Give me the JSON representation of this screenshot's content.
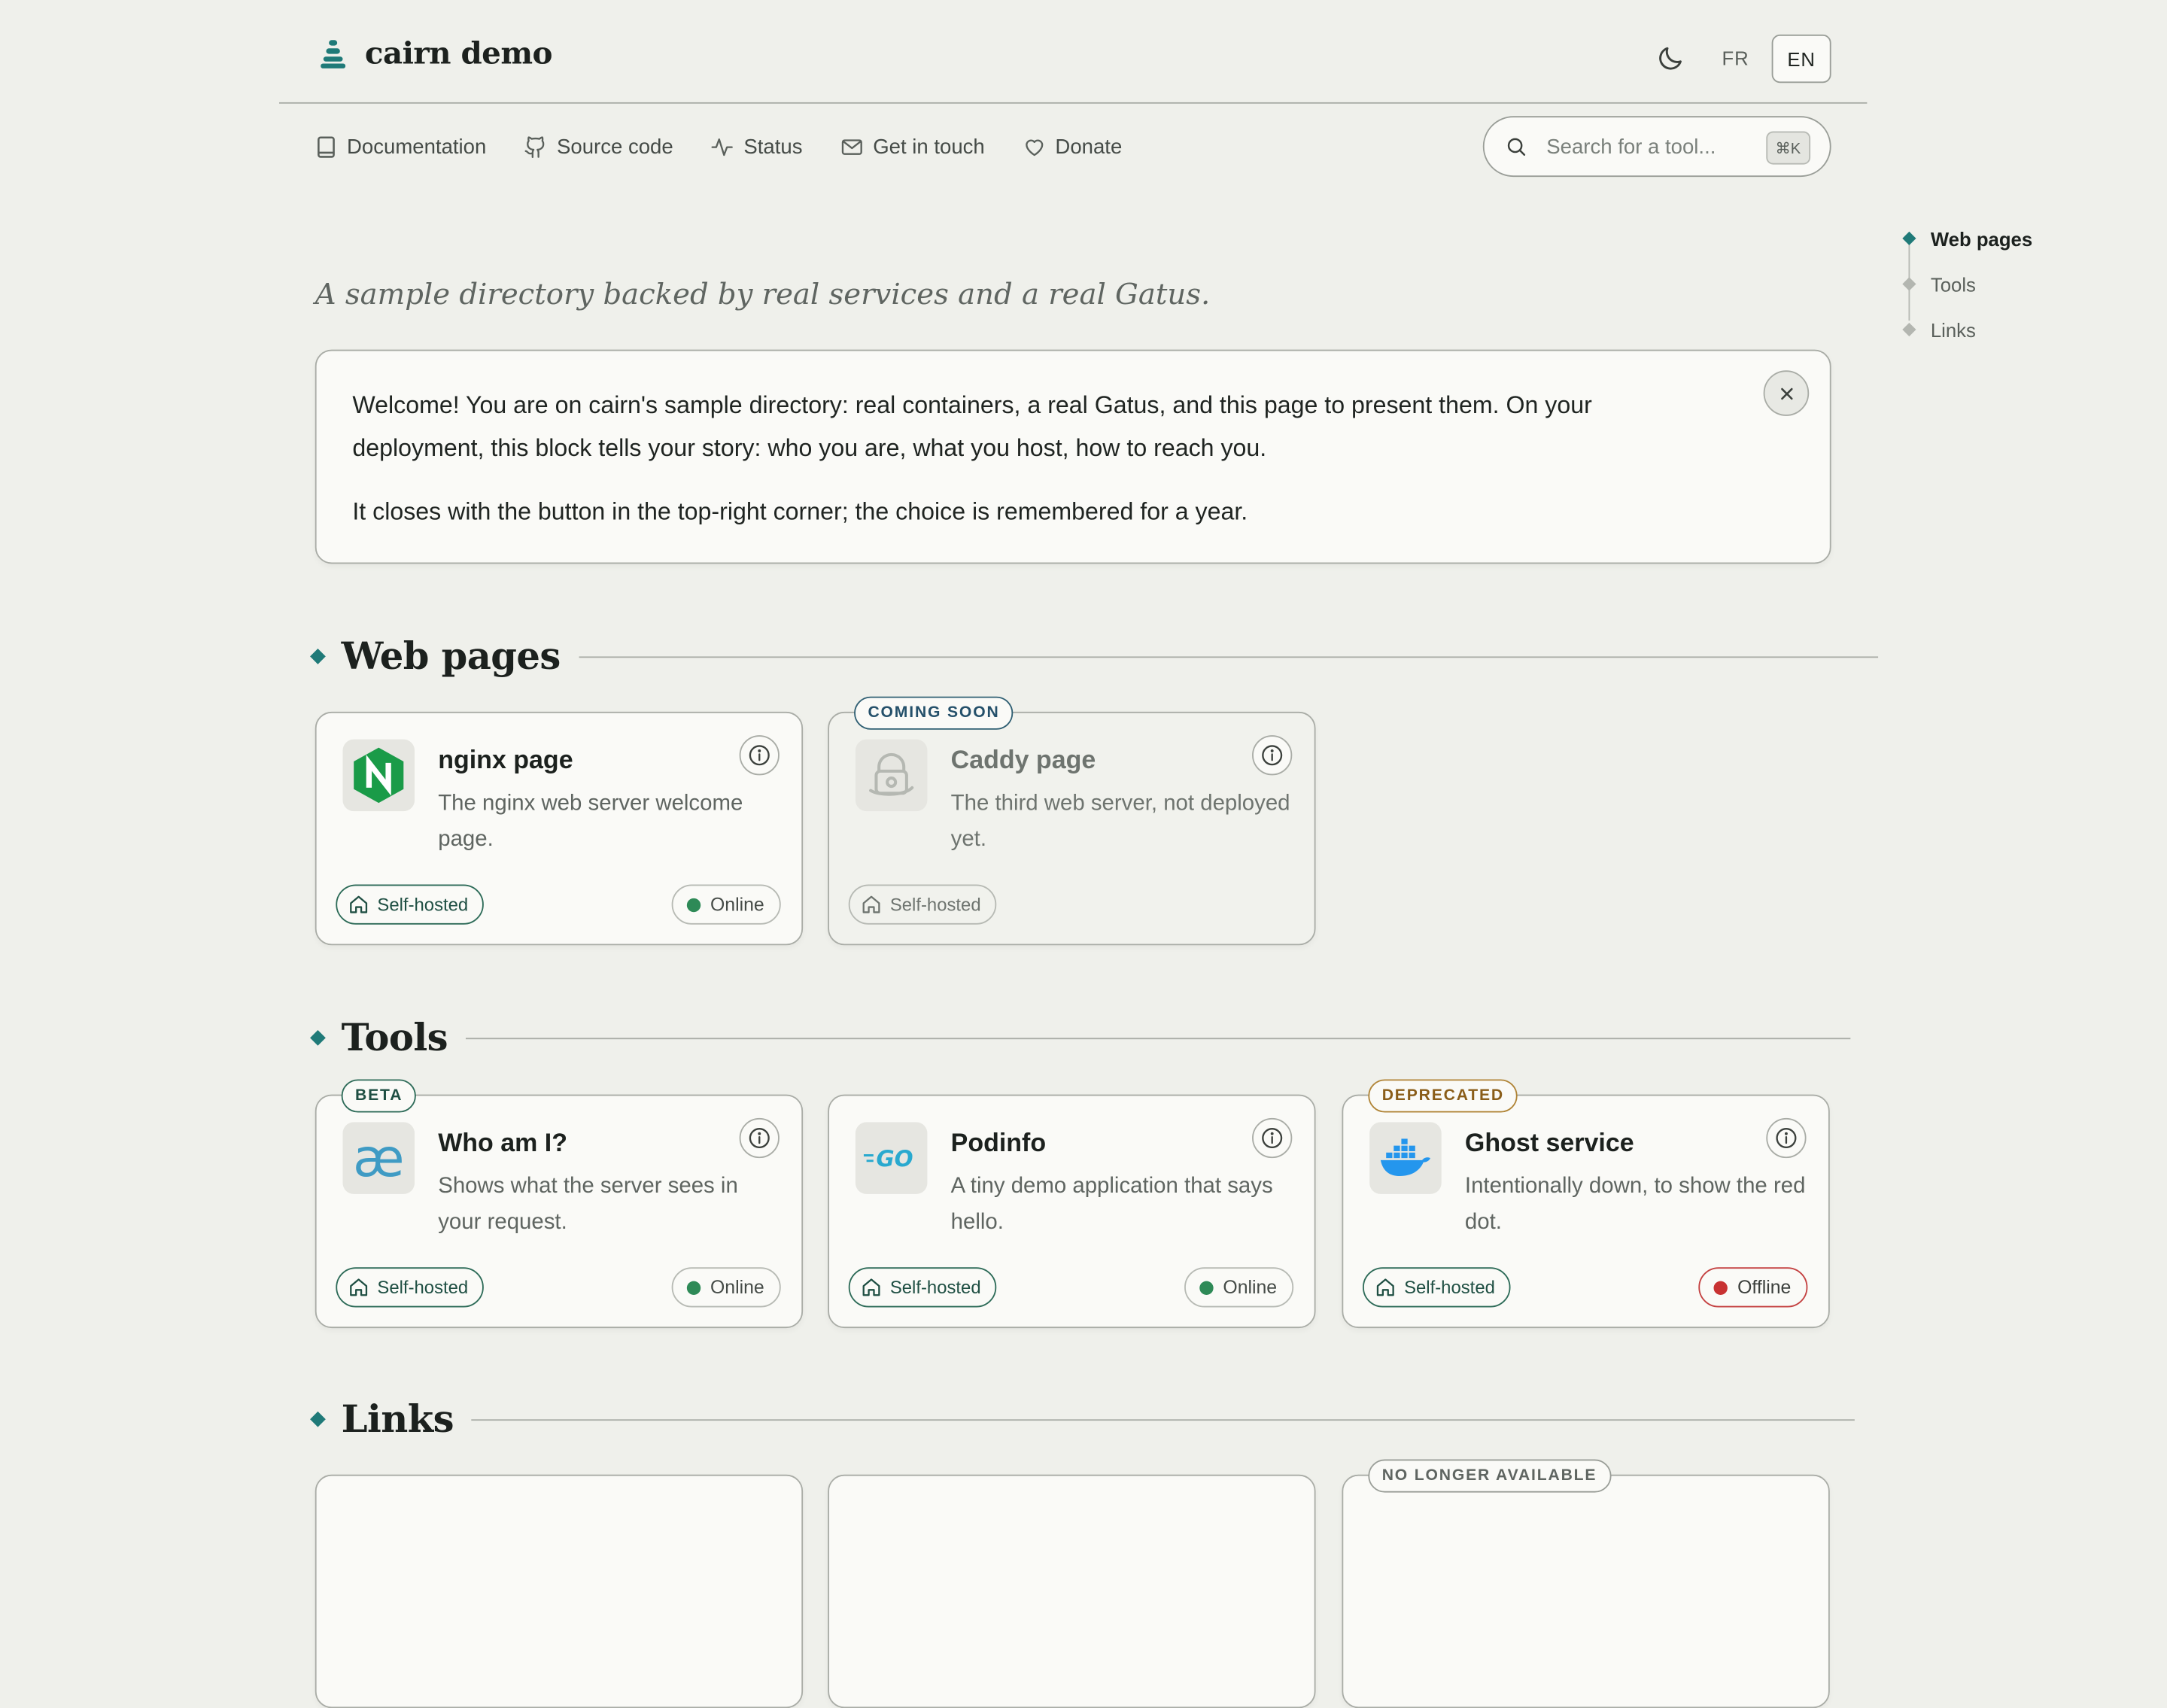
{
  "header": {
    "brand": "cairn demo",
    "lang_fr": "FR",
    "lang_en": "EN"
  },
  "nav": {
    "documentation": "Documentation",
    "source_code": "Source code",
    "status": "Status",
    "get_in_touch": "Get in touch",
    "donate": "Donate"
  },
  "search": {
    "placeholder": "Search for a tool...",
    "shortcut": "⌘K"
  },
  "toc": {
    "items": [
      "Web pages",
      "Tools",
      "Links"
    ],
    "active": "Web pages"
  },
  "tagline": "A sample directory backed by real services and a real Gatus.",
  "welcome": {
    "p1": "Welcome! You are on cairn's sample directory: real containers, a real Gatus, and this page to present them. On your deployment, this block tells your story: who you are, what you host, how to reach you.",
    "p2": "It closes with the button in the top-right corner; the choice is remembered for a year."
  },
  "sections": {
    "web_pages": {
      "title": "Web pages",
      "cards": [
        {
          "name": "nginx page",
          "description": "The nginx web server welcome page.",
          "hosting": "Self-hosted",
          "status": "Online",
          "icon": "nginx-logo"
        },
        {
          "name": "Caddy page",
          "description": "The third web server, not deployed yet.",
          "hosting": "Self-hosted",
          "badge": "COMING SOON",
          "icon": "caddy-logo"
        }
      ]
    },
    "tools": {
      "title": "Tools",
      "cards": [
        {
          "name": "Who am I?",
          "description": "Shows what the server sees in your request.",
          "hosting": "Self-hosted",
          "status": "Online",
          "badge": "BETA",
          "icon": "whoami-logo"
        },
        {
          "name": "Podinfo",
          "description": "A tiny demo application that says hello.",
          "hosting": "Self-hosted",
          "status": "Online",
          "icon": "go-logo"
        },
        {
          "name": "Ghost service",
          "description": "Intentionally down, to show the red dot.",
          "hosting": "Self-hosted",
          "status": "Offline",
          "badge": "DEPRECATED",
          "icon": "docker-logo"
        }
      ]
    },
    "links": {
      "title": "Links",
      "cards": [
        {
          "badge": "NO LONGER AVAILABLE"
        }
      ]
    }
  },
  "colors": {
    "background": "#eff0eb",
    "accent": "#1f7a78",
    "online": "#2e8a57",
    "offline": "#c83232"
  }
}
